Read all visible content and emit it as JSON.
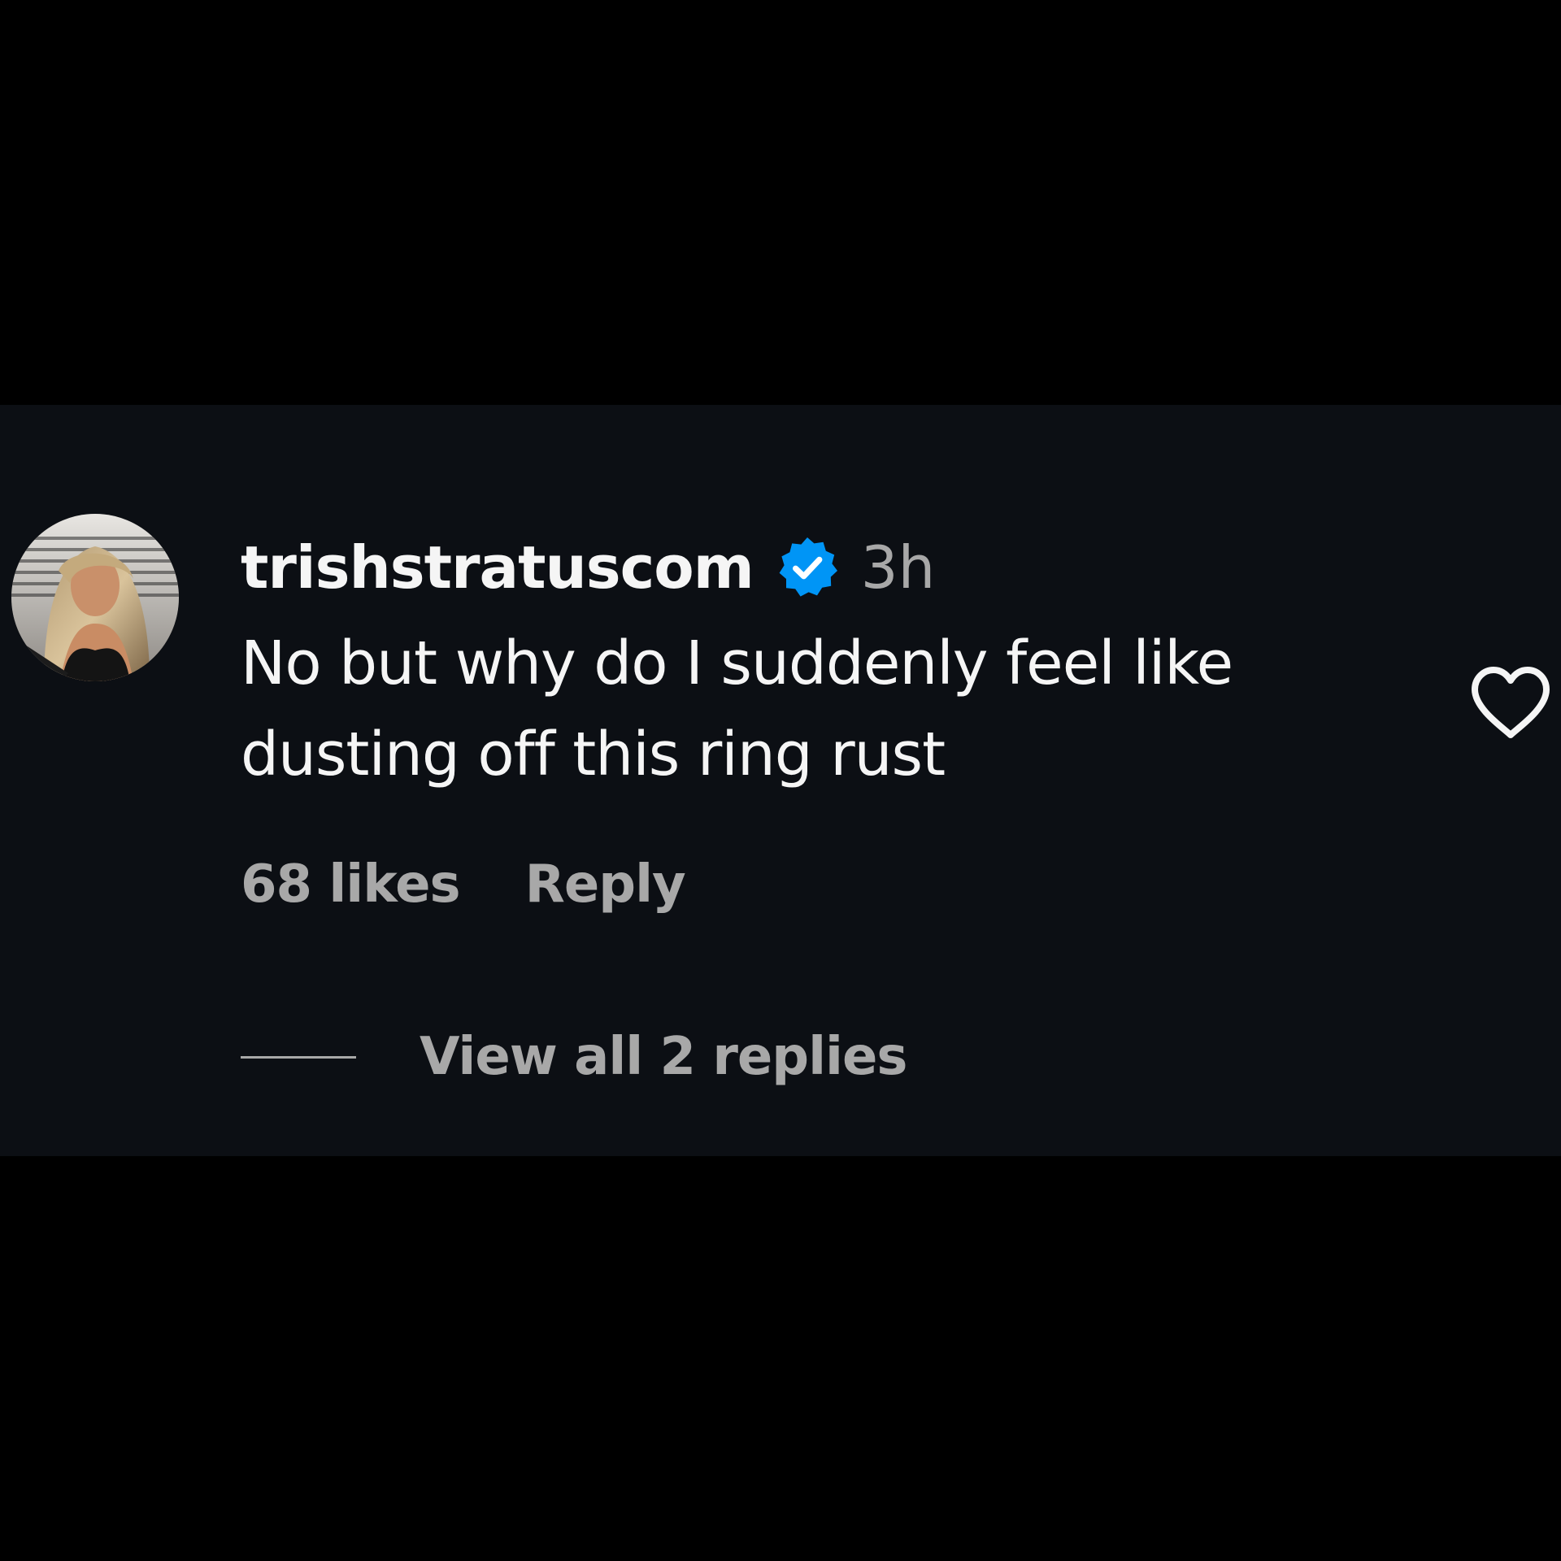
{
  "comment": {
    "username": "trishstratuscom",
    "verified_icon": "verified-badge-icon",
    "timestamp": "3h",
    "text": "No but why do I suddenly feel like dusting off this ring rust",
    "likes": "68 likes",
    "reply_label": "Reply",
    "view_replies_label": "View all 2 replies",
    "like_icon": "heart-outline-icon"
  },
  "colors": {
    "background": "#0c0f14",
    "primary_text": "#f5f5f5",
    "secondary_text": "#a8a8a8",
    "verified_blue": "#0095f6"
  }
}
